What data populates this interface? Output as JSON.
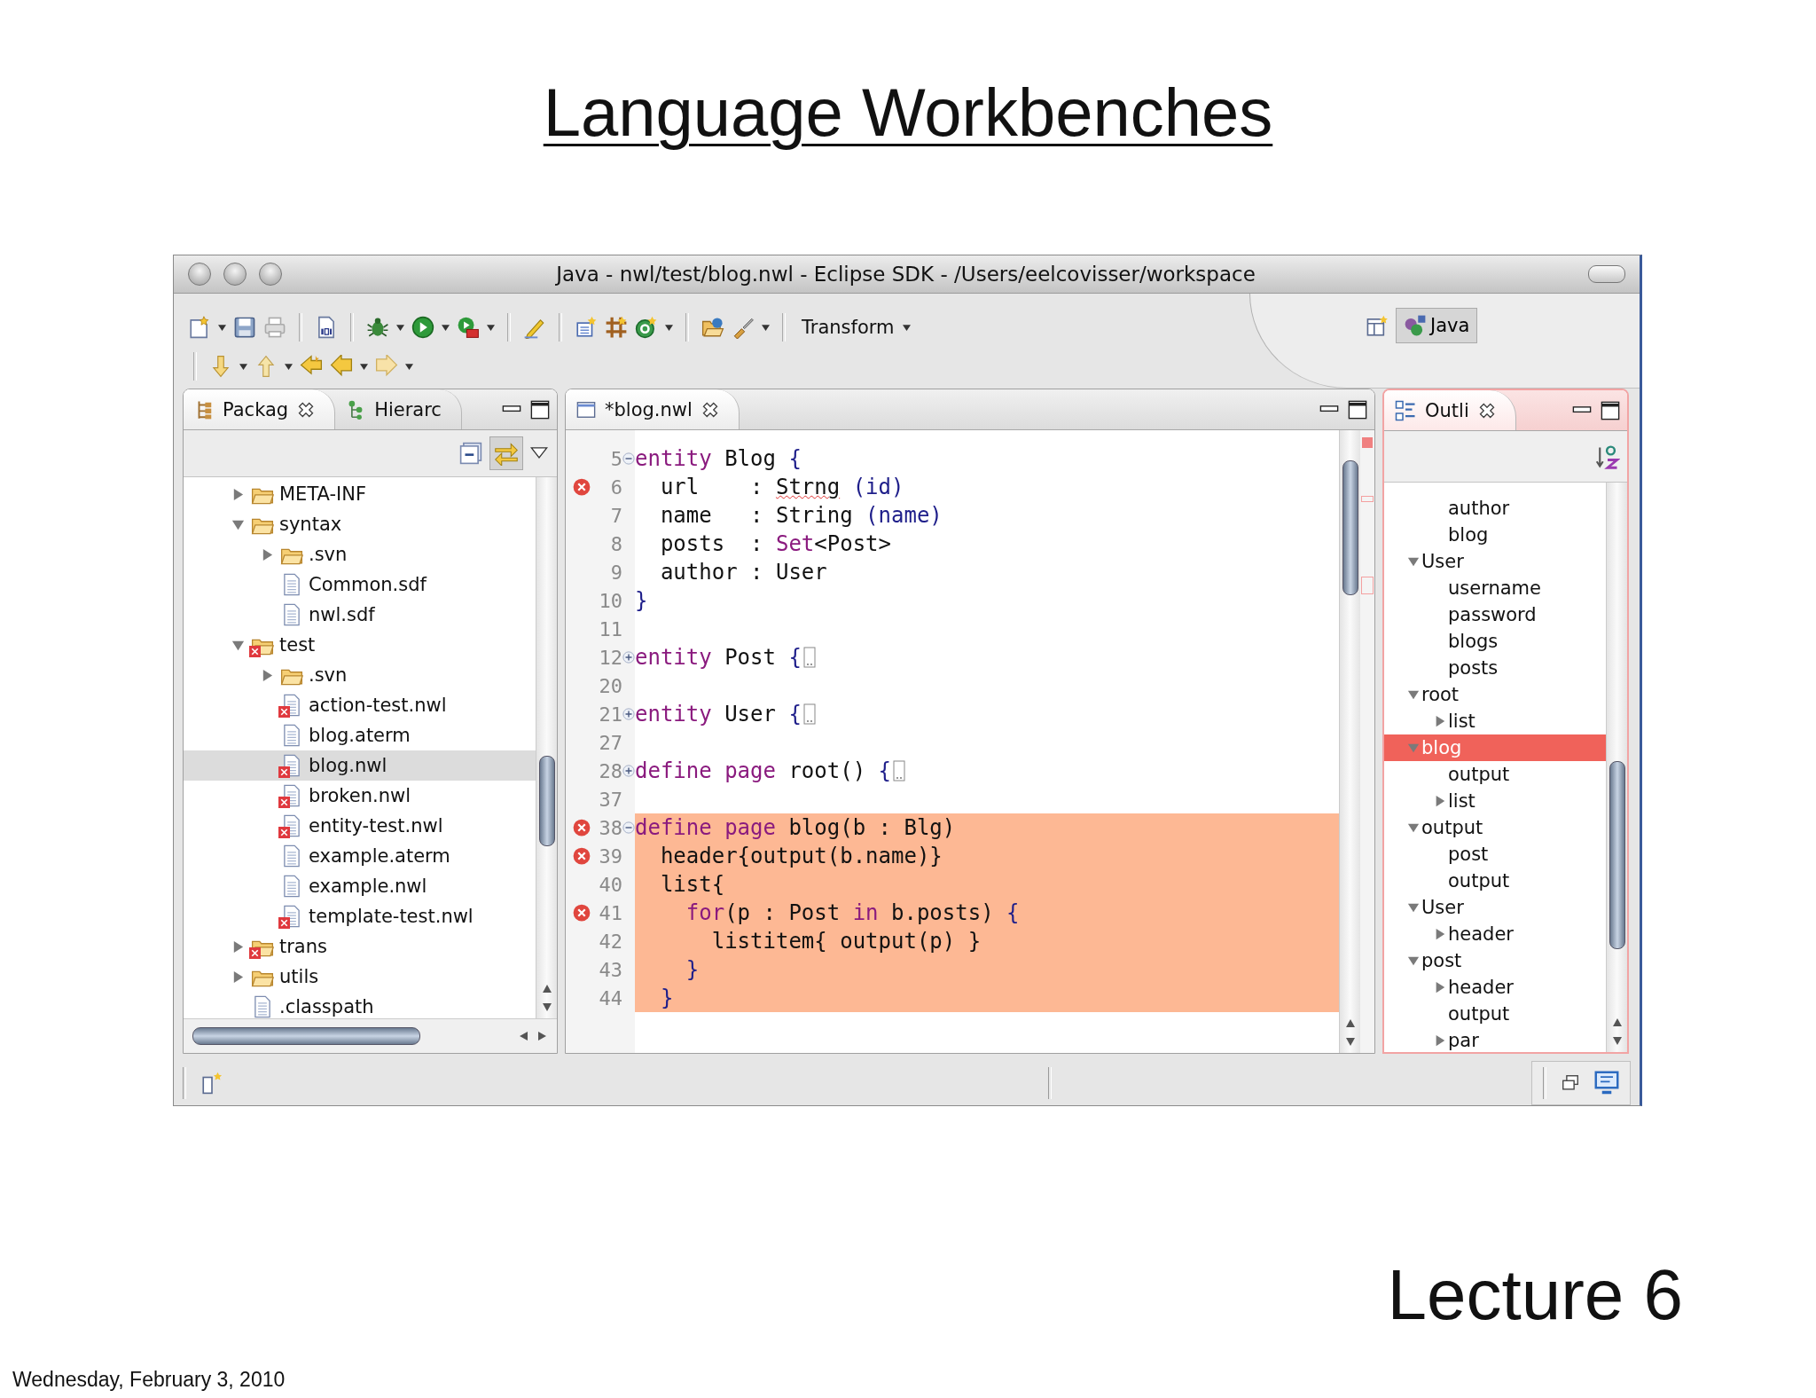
{
  "slide": {
    "title": "Language Workbenches",
    "lecture": "Lecture 6",
    "date": "Wednesday, February 3, 2010"
  },
  "window": {
    "title": "Java - nwl/test/blog.nwl - Eclipse SDK - /Users/eelcovisser/workspace"
  },
  "toolbar": {
    "menu_label": "Transform",
    "perspective": {
      "label": "Java",
      "selected": true
    }
  },
  "package_explorer": {
    "tabs": [
      {
        "label": "Packag",
        "selected": true
      },
      {
        "label": "Hierarc",
        "selected": false
      }
    ],
    "link_with_editor": {
      "on": true
    },
    "tree": [
      {
        "label": "META-INF",
        "kind": "folder",
        "expanded": false,
        "error": false,
        "selected": false
      },
      {
        "label": "syntax",
        "kind": "folder",
        "expanded": true,
        "error": false,
        "selected": false,
        "children": [
          {
            "label": ".svn",
            "kind": "folder",
            "expanded": false,
            "error": false,
            "selected": false
          },
          {
            "label": "Common.sdf",
            "kind": "file",
            "error": false,
            "selected": false
          },
          {
            "label": "nwl.sdf",
            "kind": "file",
            "error": false,
            "selected": false
          }
        ]
      },
      {
        "label": "test",
        "kind": "folder",
        "expanded": true,
        "error": true,
        "selected": false,
        "children": [
          {
            "label": ".svn",
            "kind": "folder",
            "expanded": false,
            "error": false,
            "selected": false
          },
          {
            "label": "action-test.nwl",
            "kind": "file",
            "error": true,
            "selected": false
          },
          {
            "label": "blog.aterm",
            "kind": "file",
            "error": false,
            "selected": false
          },
          {
            "label": "blog.nwl",
            "kind": "file",
            "error": true,
            "selected": true
          },
          {
            "label": "broken.nwl",
            "kind": "file",
            "error": true,
            "selected": false
          },
          {
            "label": "entity-test.nwl",
            "kind": "file",
            "error": true,
            "selected": false
          },
          {
            "label": "example.aterm",
            "kind": "file",
            "error": false,
            "selected": false
          },
          {
            "label": "example.nwl",
            "kind": "file",
            "error": false,
            "selected": false
          },
          {
            "label": "template-test.nwl",
            "kind": "file",
            "error": true,
            "selected": false
          }
        ]
      },
      {
        "label": "trans",
        "kind": "folder",
        "expanded": false,
        "error": true,
        "selected": false
      },
      {
        "label": "utils",
        "kind": "folder",
        "expanded": false,
        "error": false,
        "selected": false
      },
      {
        "label": ".classpath",
        "kind": "file",
        "error": false,
        "selected": false
      }
    ]
  },
  "editor": {
    "tab": {
      "label": "*blog.nwl",
      "selected": true
    },
    "lines": [
      {
        "number": "5",
        "error": false,
        "foldable": true,
        "folded": false,
        "highlight": false,
        "tokens": [
          {
            "kind": "keyword",
            "text": "entity"
          },
          {
            "kind": "plain",
            "text": " Blog "
          },
          {
            "kind": "brace",
            "text": "{"
          }
        ]
      },
      {
        "number": "6",
        "error": true,
        "foldable": false,
        "folded": false,
        "highlight": false,
        "tokens": [
          {
            "kind": "plain",
            "text": "  url    : "
          },
          {
            "kind": "misspelled",
            "text": "Strng"
          },
          {
            "kind": "brace",
            "text": " (id)"
          }
        ]
      },
      {
        "number": "7",
        "error": false,
        "foldable": false,
        "folded": false,
        "highlight": false,
        "tokens": [
          {
            "kind": "plain",
            "text": "  name   : String "
          },
          {
            "kind": "brace",
            "text": "(name)"
          }
        ]
      },
      {
        "number": "8",
        "error": false,
        "foldable": false,
        "folded": false,
        "highlight": false,
        "tokens": [
          {
            "kind": "plain",
            "text": "  posts  : "
          },
          {
            "kind": "keyword",
            "text": "Set"
          },
          {
            "kind": "plain",
            "text": "<Post>"
          }
        ]
      },
      {
        "number": "9",
        "error": false,
        "foldable": false,
        "folded": false,
        "highlight": false,
        "tokens": [
          {
            "kind": "plain",
            "text": "  author : User"
          }
        ]
      },
      {
        "number": "10",
        "error": false,
        "foldable": false,
        "folded": false,
        "highlight": false,
        "tokens": [
          {
            "kind": "brace",
            "text": "}"
          }
        ]
      },
      {
        "number": "11",
        "error": false,
        "foldable": false,
        "folded": false,
        "highlight": false
      },
      {
        "number": "12",
        "error": false,
        "foldable": true,
        "folded": true,
        "highlight": false,
        "tokens": [
          {
            "kind": "keyword",
            "text": "entity"
          },
          {
            "kind": "plain",
            "text": " Post "
          },
          {
            "kind": "brace",
            "text": "{"
          }
        ]
      },
      {
        "number": "20",
        "error": false,
        "foldable": false,
        "folded": false,
        "highlight": false
      },
      {
        "number": "21",
        "error": false,
        "foldable": true,
        "folded": true,
        "highlight": false,
        "tokens": [
          {
            "kind": "keyword",
            "text": "entity"
          },
          {
            "kind": "plain",
            "text": " User "
          },
          {
            "kind": "brace",
            "text": "{"
          }
        ]
      },
      {
        "number": "27",
        "error": false,
        "foldable": false,
        "folded": false,
        "highlight": false
      },
      {
        "number": "28",
        "error": false,
        "foldable": true,
        "folded": true,
        "highlight": false,
        "tokens": [
          {
            "kind": "keyword",
            "text": "define"
          },
          {
            "kind": "keyword",
            "text": " page"
          },
          {
            "kind": "plain",
            "text": " root() "
          },
          {
            "kind": "brace",
            "text": "{"
          }
        ]
      },
      {
        "number": "37",
        "error": false,
        "foldable": false,
        "folded": false,
        "highlight": false
      },
      {
        "number": "38",
        "error": true,
        "foldable": true,
        "folded": false,
        "highlight": true,
        "tokens": [
          {
            "kind": "keyword",
            "text": "define"
          },
          {
            "kind": "keyword",
            "text": " page"
          },
          {
            "kind": "plain",
            "text": " blog(b : Blg)"
          }
        ]
      },
      {
        "number": "39",
        "error": true,
        "foldable": false,
        "folded": false,
        "highlight": true,
        "tokens": [
          {
            "kind": "plain",
            "text": "  header{output(b.name)}"
          }
        ]
      },
      {
        "number": "40",
        "error": false,
        "foldable": false,
        "folded": false,
        "highlight": true,
        "tokens": [
          {
            "kind": "plain",
            "text": "  list{"
          }
        ]
      },
      {
        "number": "41",
        "error": true,
        "foldable": false,
        "folded": false,
        "highlight": true,
        "tokens": [
          {
            "kind": "keyword",
            "text": "    for"
          },
          {
            "kind": "plain",
            "text": "(p : Post "
          },
          {
            "kind": "keyword",
            "text": "in"
          },
          {
            "kind": "plain",
            "text": " b.posts) "
          },
          {
            "kind": "brace",
            "text": "{"
          }
        ]
      },
      {
        "number": "42",
        "error": false,
        "foldable": false,
        "folded": false,
        "highlight": true,
        "tokens": [
          {
            "kind": "plain",
            "text": "      listitem{ output(p) }"
          }
        ]
      },
      {
        "number": "43",
        "error": false,
        "foldable": false,
        "folded": false,
        "highlight": true,
        "tokens": [
          {
            "kind": "brace",
            "text": "    }"
          }
        ]
      },
      {
        "number": "44",
        "error": false,
        "foldable": false,
        "folded": false,
        "highlight": true,
        "tokens": [
          {
            "kind": "brace",
            "text": "  }"
          }
        ]
      }
    ]
  },
  "outline": {
    "tab": {
      "label": "Outli",
      "selected": true
    },
    "tree": [
      {
        "children": [
          {
            "label": "author",
            "selected": false
          },
          {
            "label": "blog",
            "selected": false
          }
        ]
      },
      {
        "label": "User",
        "expanded": true,
        "selected": false,
        "children": [
          {
            "label": "username",
            "selected": false
          },
          {
            "label": "password",
            "selected": false
          },
          {
            "label": "blogs",
            "selected": false
          },
          {
            "label": "posts",
            "selected": false
          }
        ]
      },
      {
        "label": "root",
        "expanded": true,
        "selected": false,
        "children": [
          {
            "label": "list",
            "expanded": false,
            "selected": false
          }
        ]
      },
      {
        "label": "blog",
        "expanded": true,
        "selected": true,
        "children": [
          {
            "label": "output",
            "selected": false
          },
          {
            "label": "list",
            "expanded": false,
            "selected": false
          }
        ]
      },
      {
        "label": "output",
        "expanded": true,
        "selected": false,
        "children": [
          {
            "label": "post",
            "selected": false
          },
          {
            "label": "output",
            "selected": false
          }
        ]
      },
      {
        "label": "User",
        "expanded": true,
        "selected": false,
        "children": [
          {
            "label": "header",
            "expanded": false,
            "selected": false
          }
        ]
      },
      {
        "label": "post",
        "expanded": true,
        "selected": false,
        "children": [
          {
            "label": "header",
            "expanded": false,
            "selected": false
          },
          {
            "label": "output",
            "selected": false
          },
          {
            "label": "par",
            "expanded": false,
            "selected": false
          }
        ]
      }
    ]
  }
}
